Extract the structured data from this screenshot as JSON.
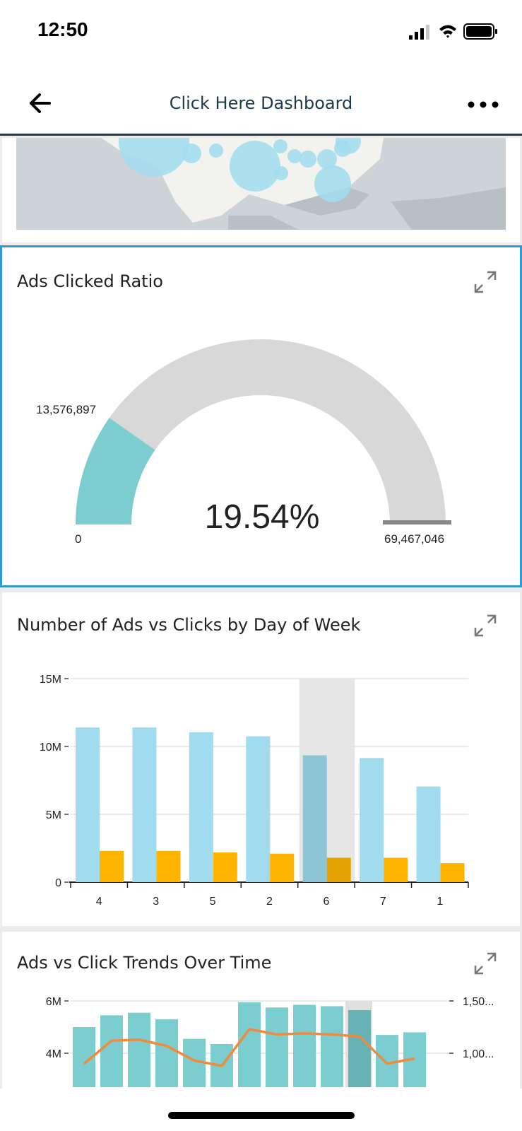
{
  "status_bar": {
    "time": "12:50"
  },
  "header": {
    "title": "Click Here Dashboard",
    "back_icon": "arrow-left-icon",
    "more_icon": "ellipsis-icon"
  },
  "colors": {
    "accent": "#2e9bd6",
    "teal": "#7ccdd0",
    "light_blue": "#a1dcee",
    "orange": "#ffb500",
    "line_orange": "#f08a3c",
    "gauge_bg": "#d8d8d8"
  },
  "gauge_widget": {
    "title": "Ads Clicked Ratio",
    "value_label": "13,576,897",
    "min_label": "0",
    "max_label": "69,467,046",
    "percent_label": "19.54%",
    "ratio": 0.1954
  },
  "bar_widget": {
    "title": "Number of Ads vs Clicks by Day of Week",
    "y_ticks": [
      "15M",
      "10M",
      "5M",
      "0"
    ]
  },
  "trend_widget": {
    "title": "Ads vs Click Trends Over Time",
    "y_ticks_left": [
      "6M",
      "4M"
    ],
    "y_ticks_right": [
      "1,50...",
      "1,00..."
    ]
  },
  "chart_data": [
    {
      "type": "bar",
      "title": "Number of Ads vs Clicks by Day of Week",
      "categories": [
        "4",
        "3",
        "5",
        "2",
        "6",
        "7",
        "1"
      ],
      "series": [
        {
          "values": [
            11400000,
            11400000,
            11050000,
            10750000,
            9350000,
            9150000,
            7050000
          ]
        },
        {
          "values": [
            2300000,
            2300000,
            2200000,
            2100000,
            1800000,
            1800000,
            1400000
          ]
        }
      ],
      "ylim": [
        0,
        15000000
      ],
      "y_ticks": [
        "15M",
        "10M",
        "5M",
        "0"
      ],
      "highlighted_category": "6",
      "grid": true
    },
    {
      "type": "bar",
      "title": "Ads vs Click Trends Over Time",
      "bars": [
        5000000,
        5450000,
        5550000,
        5300000,
        4550000,
        4350000,
        5950000,
        5750000,
        5850000,
        5800000,
        5650000,
        4700000,
        4800000
      ],
      "line": [
        900000,
        1120000,
        1130000,
        1070000,
        930000,
        880000,
        1230000,
        1180000,
        1190000,
        1180000,
        1160000,
        900000,
        950000
      ],
      "ylim_left": [
        3000000,
        6000000
      ],
      "ylim_right": [
        500000,
        1500000
      ],
      "y_ticks_left": [
        "6M",
        "4M"
      ],
      "y_ticks_right": [
        "1,50...",
        "1,00..."
      ],
      "highlighted_index": 10
    }
  ]
}
